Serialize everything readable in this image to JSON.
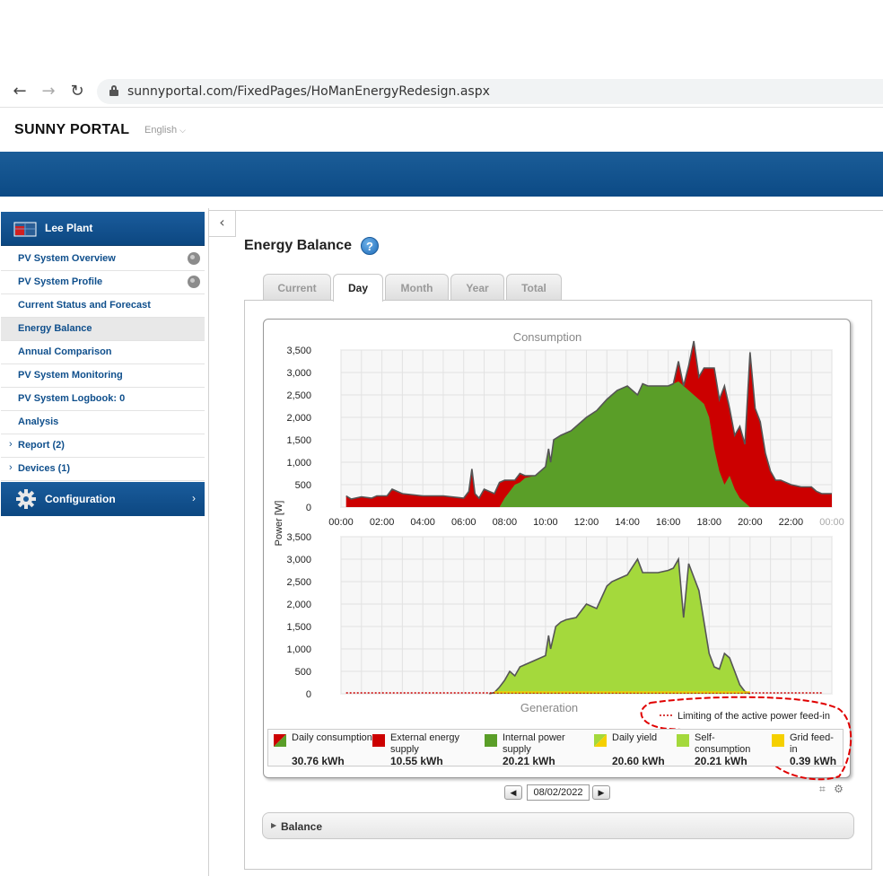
{
  "browser": {
    "url": "sunnyportal.com/FixedPages/HoManEnergyRedesign.aspx"
  },
  "header": {
    "logo": "SUNNY PORTAL",
    "language": "English"
  },
  "sidebar": {
    "plant": "Lee Plant",
    "items": [
      {
        "label": "PV System Overview",
        "globe": true
      },
      {
        "label": "PV System Profile",
        "globe": true
      },
      {
        "label": "Current Status and Forecast"
      },
      {
        "label": "Energy Balance",
        "active": true
      },
      {
        "label": "Annual Comparison"
      },
      {
        "label": "PV System Monitoring"
      },
      {
        "label": "PV System Logbook: 0"
      },
      {
        "label": "Analysis"
      },
      {
        "label": "Report (2)",
        "expandable": true
      },
      {
        "label": "Devices (1)",
        "expandable": true
      }
    ],
    "config": "Configuration"
  },
  "main": {
    "title": "Energy Balance",
    "help": "?",
    "tabs": [
      "Current",
      "Day",
      "Month",
      "Year",
      "Total"
    ],
    "active_tab": "Day",
    "date": "08/02/2022",
    "balance_label": "Balance"
  },
  "chart_data": [
    {
      "type": "area",
      "title": "Consumption",
      "ylabel": "Power [W]",
      "ylim": [
        0,
        3500
      ],
      "yticks": [
        "3,500",
        "3,000",
        "2,500",
        "2,000",
        "1,500",
        "1,000",
        "500",
        "0"
      ],
      "xticks": [
        "00:00",
        "02:00",
        "04:00",
        "06:00",
        "08:00",
        "10:00",
        "12:00",
        "14:00",
        "16:00",
        "18:00",
        "20:00",
        "22:00",
        "00:00"
      ],
      "x_hours": [
        0.25,
        0.5,
        1,
        1.5,
        1.75,
        2.25,
        2.5,
        3,
        4,
        5,
        6,
        6.25,
        6.4,
        6.55,
        6.75,
        7,
        7.25,
        7.5,
        7.75,
        8,
        8.5,
        8.75,
        9,
        9.5,
        10,
        10.15,
        10.25,
        10.4,
        10.75,
        11,
        11.25,
        11.5,
        12,
        12.5,
        13,
        13.25,
        13.5,
        14,
        14.5,
        14.75,
        15,
        15.5,
        16,
        16.25,
        16.5,
        16.75,
        17,
        17.25,
        17.5,
        17.75,
        18,
        18.25,
        18.5,
        18.75,
        19,
        19.25,
        19.5,
        19.75,
        20,
        20.25,
        20.5,
        20.75,
        21,
        21.25,
        21.5,
        22,
        22.5,
        23,
        23.25,
        23.5,
        24
      ],
      "series": [
        {
          "name": "Internal power supply",
          "color": "#5a9e28",
          "values": [
            0,
            0,
            0,
            0,
            0,
            0,
            0,
            0,
            0,
            0,
            0,
            0,
            0,
            0,
            0,
            0,
            0,
            0,
            0,
            200,
            500,
            550,
            650,
            700,
            900,
            1300,
            1000,
            1500,
            1600,
            1650,
            1700,
            1800,
            2000,
            2150,
            2400,
            2500,
            2600,
            2700,
            2500,
            2750,
            2700,
            2700,
            2700,
            2750,
            2800,
            2700,
            2600,
            2500,
            2400,
            2300,
            2000,
            1300,
            800,
            500,
            700,
            400,
            200,
            100,
            0,
            0,
            0,
            0,
            0,
            0,
            0,
            0,
            0,
            0,
            0,
            0,
            0
          ]
        },
        {
          "name": "External energy supply",
          "color": "#cc0000",
          "values": [
            250,
            180,
            230,
            200,
            250,
            250,
            400,
            300,
            250,
            250,
            200,
            350,
            850,
            300,
            200,
            400,
            350,
            300,
            550,
            400,
            100,
            200,
            50,
            0,
            0,
            0,
            0,
            0,
            0,
            0,
            0,
            0,
            0,
            0,
            0,
            0,
            0,
            0,
            0,
            0,
            0,
            0,
            0,
            0,
            450,
            -1100,
            550,
            1200,
            500,
            800,
            1100,
            1800,
            1600,
            2200,
            1500,
            1200,
            1600,
            1300,
            3450,
            2200,
            1900,
            1200,
            800,
            600,
            600,
            500,
            450,
            450,
            350,
            300,
            300
          ]
        }
      ]
    },
    {
      "type": "area",
      "title": "Generation",
      "ylim": [
        0,
        3500
      ],
      "yticks": [
        "3,500",
        "3,000",
        "2,500",
        "2,000",
        "1,500",
        "1,000",
        "500",
        "0"
      ],
      "x_hours": [
        7.25,
        7.5,
        7.75,
        8,
        8.25,
        8.5,
        8.75,
        9,
        9.5,
        10,
        10.15,
        10.25,
        10.5,
        10.75,
        11,
        11.5,
        12,
        12.5,
        13,
        13.25,
        13.5,
        14,
        14.5,
        14.75,
        15,
        15.5,
        16,
        16.25,
        16.5,
        16.75,
        17,
        17.25,
        17.5,
        17.75,
        18,
        18.25,
        18.5,
        18.75,
        19,
        19.25,
        19.5,
        19.75,
        20
      ],
      "series": [
        {
          "name": "Self-consumption",
          "color": "#a4d93c",
          "values": [
            0,
            30,
            150,
            300,
            500,
            400,
            600,
            650,
            750,
            850,
            1300,
            1000,
            1500,
            1600,
            1650,
            1700,
            2000,
            1900,
            2400,
            2500,
            2550,
            2650,
            3000,
            2700,
            2700,
            2700,
            2750,
            2800,
            3000,
            1700,
            2900,
            2600,
            2300,
            1600,
            900,
            600,
            550,
            900,
            800,
            500,
            200,
            50,
            0
          ]
        },
        {
          "name": "Grid feed-in",
          "color": "#f5d000",
          "values": []
        }
      ],
      "annotation": "Limiting of the active power feed-in"
    }
  ],
  "legend": [
    {
      "label": "Daily consumption",
      "value": "30.76 kWh",
      "swatch": "split-red-green"
    },
    {
      "label": "External energy supply",
      "value": "10.55 kWh",
      "swatch": "#cc0000"
    },
    {
      "label": "Internal power supply",
      "value": "20.21 kWh",
      "swatch": "#5a9e28"
    },
    {
      "label": "Daily yield",
      "value": "20.60 kWh",
      "swatch": "split-green-yellow"
    },
    {
      "label": "Self-consumption",
      "value": "20.21 kWh",
      "swatch": "#a4d93c"
    },
    {
      "label": "Grid feed-in",
      "value": "0.39 kWh",
      "swatch": "#f5d000"
    }
  ]
}
